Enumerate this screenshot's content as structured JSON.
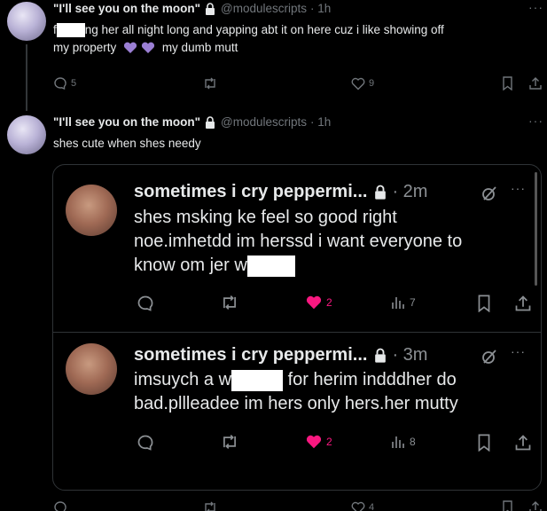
{
  "tweet1": {
    "name": "\"I'll see you on the moon\"",
    "handle": "@modulescripts",
    "time": "· 1h",
    "text_before": "f",
    "text_after": "ng her all night long and yapping abt it on here cuz i like showing off",
    "line2_before": "my property",
    "line2_after": "my dumb mutt",
    "reply_count": "5",
    "like_count": "9"
  },
  "tweet2": {
    "name": "\"I'll see you on the moon\"",
    "handle": "@modulescripts",
    "time": "· 1h",
    "text": "shes cute when shes needy"
  },
  "quote1": {
    "name": "sometimes i cry peppermi...",
    "time": "· 2m",
    "line1": "shes msking ke feel so good right",
    "line2": "noe.imhetdd im herssd i want everyone to",
    "line3_before": "know om jer w",
    "like_count": "2",
    "view_count": "7"
  },
  "quote2": {
    "name": "sometimes i cry peppermi...",
    "time": "· 3m",
    "line1_before": "imsuych a w",
    "line1_after": "for herim indddher do",
    "line2": "bad.pllleadee im hers only hers.her mutty",
    "like_count": "2",
    "view_count": "8"
  },
  "footer": {
    "like_count": "4"
  },
  "colors": {
    "background": "#000000",
    "text": "#e7e9ea",
    "muted": "#71767b",
    "like_pink": "#f91880",
    "heart_purple": "#9b7fd4"
  },
  "icons": [
    "lock-icon",
    "more-icon",
    "reply-icon",
    "retweet-icon",
    "like-icon",
    "views-icon",
    "bookmark-icon",
    "share-icon",
    "grok-icon",
    "purple-heart-icon"
  ]
}
